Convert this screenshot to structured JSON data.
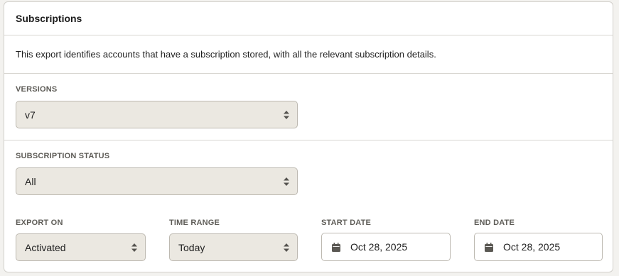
{
  "header": {
    "title": "Subscriptions"
  },
  "description": "This export identifies accounts that have a subscription stored, with all the relevant subscription details.",
  "versions": {
    "label": "VERSIONS",
    "value": "v7"
  },
  "subscription_status": {
    "label": "SUBSCRIPTION STATUS",
    "value": "All"
  },
  "export_on": {
    "label": "EXPORT ON",
    "value": "Activated"
  },
  "time_range": {
    "label": "TIME RANGE",
    "value": "Today"
  },
  "start_date": {
    "label": "START DATE",
    "value": "Oct 28, 2025"
  },
  "end_date": {
    "label": "END DATE",
    "value": "Oct 28, 2025"
  },
  "colors": {
    "select_bg": "#ebe8e1",
    "border": "#bdb9b1",
    "label": "#5e5c57"
  },
  "icons": {
    "select_arrows": "updown-chevron-icon",
    "date": "calendar-icon"
  }
}
